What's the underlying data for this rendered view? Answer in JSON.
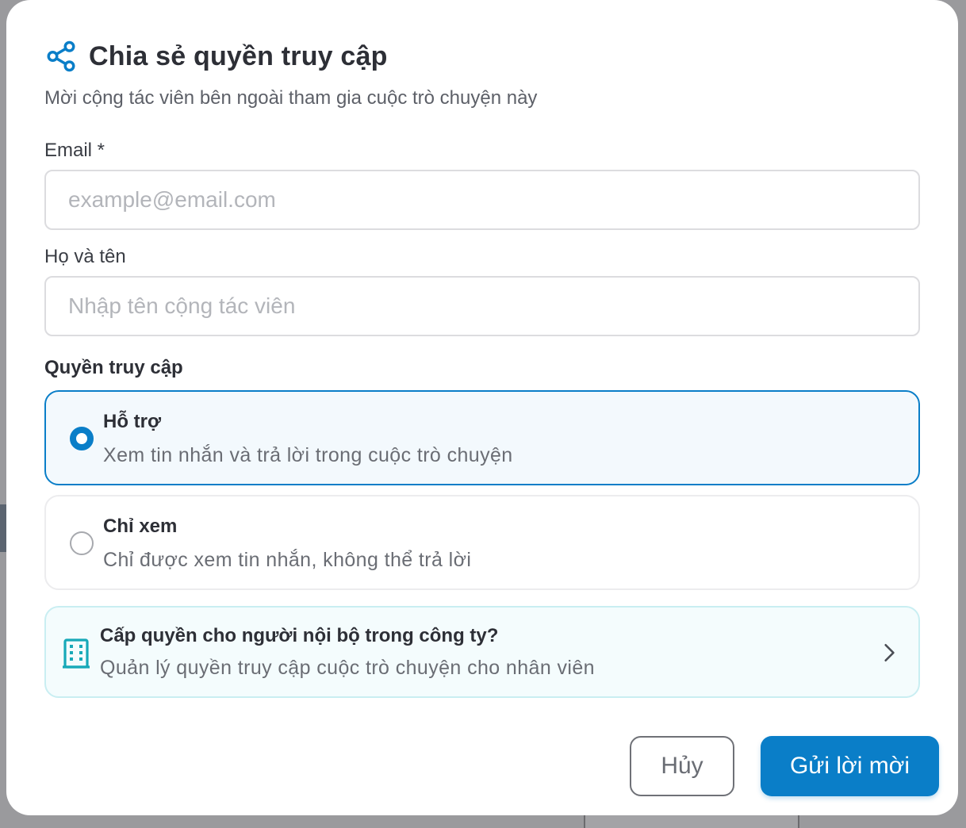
{
  "header": {
    "title": "Chia sẻ quyền truy cập",
    "subtitle": "Mời cộng tác viên bên ngoài tham gia cuộc trò chuyện này",
    "icon": "share-icon"
  },
  "form": {
    "email_label": "Email *",
    "email_placeholder": "example@email.com",
    "email_value": "",
    "name_label": "Họ và tên",
    "name_placeholder": "Nhập tên cộng tác viên",
    "name_value": ""
  },
  "access": {
    "label": "Quyền truy cập",
    "options": [
      {
        "title": "Hỗ trợ",
        "description": "Xem tin nhắn và trả lời trong cuộc trò chuyện",
        "selected": true
      },
      {
        "title": "Chỉ xem",
        "description": "Chỉ được xem tin nhắn, không thể trả lời",
        "selected": false
      }
    ]
  },
  "internal": {
    "title": "Cấp quyền cho người nội bộ trong công ty?",
    "description": "Quản lý quyền truy cập cuộc trò chuyện cho nhân viên",
    "icon": "building-icon"
  },
  "actions": {
    "cancel_label": "Hủy",
    "send_label": "Gửi lời mời"
  },
  "colors": {
    "accent": "#0a7ec8",
    "teal": "#17a9b8",
    "backdrop": "#9a9a9d"
  }
}
